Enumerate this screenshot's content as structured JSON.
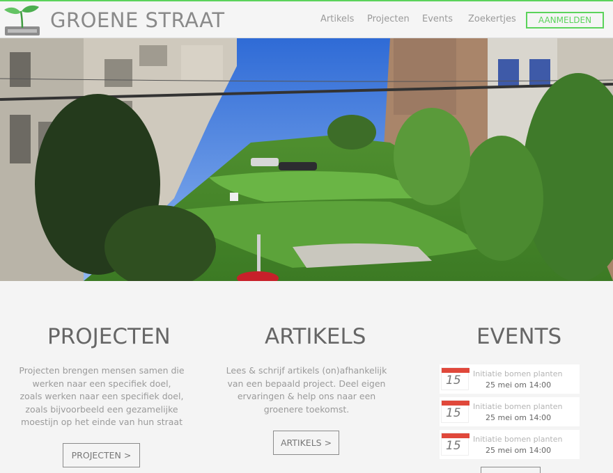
{
  "brand": {
    "name": "GROENE STRAAT"
  },
  "nav": {
    "items": [
      "Artikels",
      "Projecten",
      "Events",
      "Zoekertjes"
    ],
    "signup_label": "AANMELDEN"
  },
  "sections": {
    "projects": {
      "title": "PROJECTEN",
      "lines": [
        "Projecten brengen mensen samen die",
        "werken naar een specifiek doel,",
        "zoals werken naar een specifiek doel,",
        "zoals bijvoorbeeld een gezamelijke",
        "moestijn op het einde van hun straat"
      ],
      "button": "PROJECTEN >"
    },
    "articles": {
      "title": "ARTIKELS",
      "lines": [
        "Lees & schrijf artikels (on)afhankelijk",
        "van een bepaald project. Deel eigen",
        "ervaringen & help ons naar een",
        "groenere toekomst."
      ],
      "button": "ARTIKELS >"
    },
    "events": {
      "title": "EVENTS",
      "items": [
        {
          "day": "15",
          "title": "Initiatie bomen planten",
          "date": "25 mei om 14:00"
        },
        {
          "day": "15",
          "title": "Initiatie bomen planten",
          "date": "25 mei om 14:00"
        },
        {
          "day": "15",
          "title": "Initiatie bomen planten",
          "date": "25 mei om 14:00"
        }
      ]
    }
  },
  "colors": {
    "accent": "#5bd35b",
    "calendar": "#e0483b"
  },
  "icons": {
    "logo": "sprout-icon"
  }
}
